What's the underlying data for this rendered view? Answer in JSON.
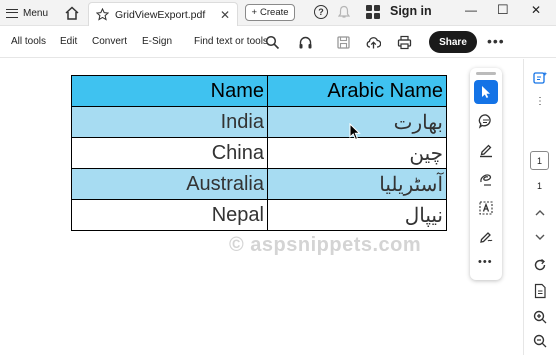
{
  "titlebar": {
    "menu_label": "Menu",
    "tab_title": "GridViewExport.pdf",
    "create_label": "Create",
    "signin_label": "Sign in"
  },
  "toolbar": {
    "all_tools": "All tools",
    "edit": "Edit",
    "convert": "Convert",
    "esign": "E-Sign",
    "find": "Find text or tools",
    "share": "Share"
  },
  "table": {
    "headers": [
      "Name",
      "Arabic Name"
    ],
    "rows": [
      [
        "India",
        "بھارت"
      ],
      [
        "China",
        "چین"
      ],
      [
        "Australia",
        "آسٹریلیا"
      ],
      [
        "Nepal",
        "نیپال"
      ]
    ],
    "header_color": "#3fc2f0",
    "alt_row_color": "#a7dcf2"
  },
  "watermark": "© aspsnippets.com",
  "page_nav": {
    "current": "1",
    "total": "1"
  },
  "accent": "#1473e6"
}
